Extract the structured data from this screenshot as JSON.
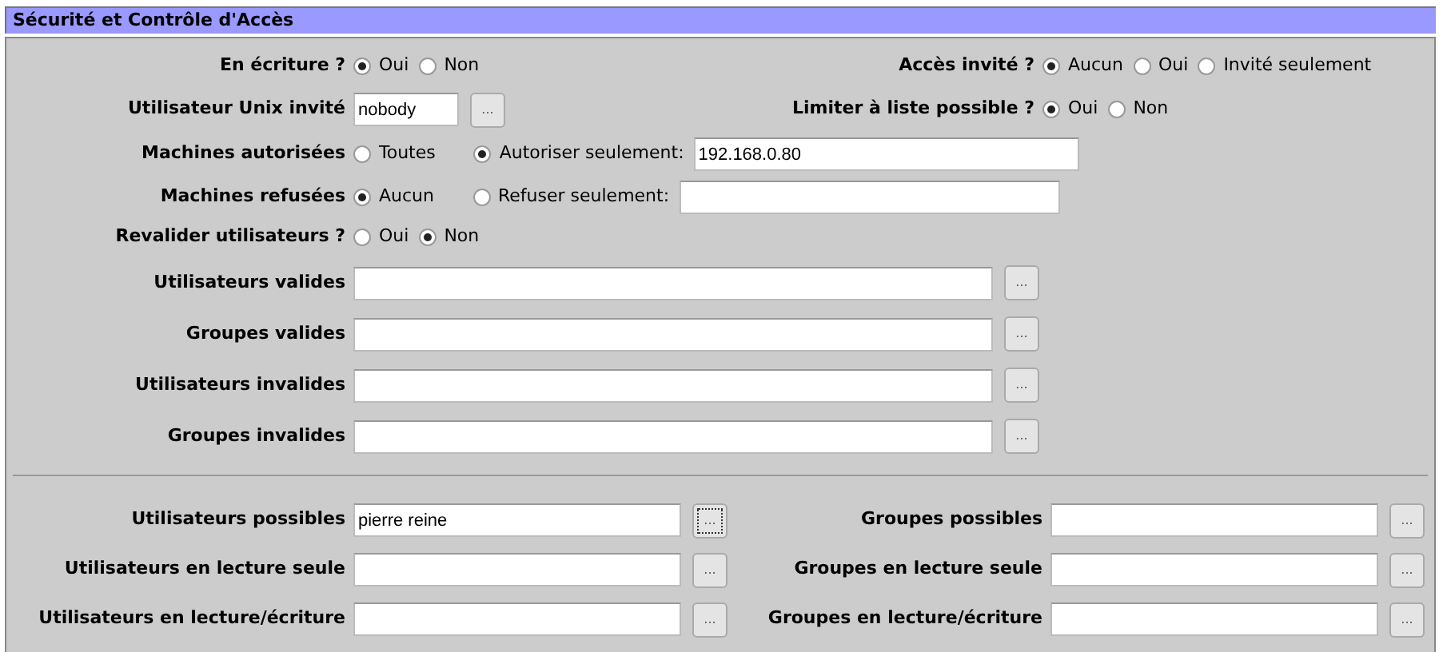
{
  "section": {
    "title": "Sécurité et Contrôle d'Accès"
  },
  "writable": {
    "label": "En écriture ?",
    "options": [
      {
        "label": "Oui",
        "selected": true
      },
      {
        "label": "Non",
        "selected": false
      }
    ]
  },
  "guest_access": {
    "label": "Accès invité ?",
    "options": [
      {
        "label": "Aucun",
        "selected": true
      },
      {
        "label": "Oui",
        "selected": false
      },
      {
        "label": "Invité seulement",
        "selected": false
      }
    ]
  },
  "guest_unix_user": {
    "label": "Utilisateur Unix invité",
    "value": "nobody",
    "button": "..."
  },
  "limit_to_possible": {
    "label": "Limiter à liste possible ?",
    "options": [
      {
        "label": "Oui",
        "selected": true
      },
      {
        "label": "Non",
        "selected": false
      }
    ]
  },
  "allowed_hosts": {
    "label": "Machines autorisées",
    "options": [
      {
        "label": "Toutes",
        "selected": false
      },
      {
        "label": "Autoriser seulement:",
        "selected": true
      }
    ],
    "value": "192.168.0.80"
  },
  "denied_hosts": {
    "label": "Machines refusées",
    "options": [
      {
        "label": "Aucun",
        "selected": true
      },
      {
        "label": "Refuser seulement:",
        "selected": false
      }
    ]
  },
  "revalidate": {
    "label": "Revalider utilisateurs ?",
    "options": [
      {
        "label": "Oui",
        "selected": false
      },
      {
        "label": "Non",
        "selected": true
      }
    ]
  },
  "user_lists": [
    {
      "label": "Utilisateurs valides",
      "button": "..."
    },
    {
      "label": "Groupes valides",
      "button": "..."
    },
    {
      "label": "Utilisateurs invalides",
      "button": "..."
    },
    {
      "label": "Groupes invalides",
      "button": "..."
    }
  ],
  "access_lists": [
    {
      "left": {
        "label": "Utilisateurs possibles",
        "value": "pierre reine",
        "button": "...",
        "focused": true
      },
      "right": {
        "label": "Groupes possibles",
        "button": "...",
        "focused": false
      }
    },
    {
      "left": {
        "label": "Utilisateurs en lecture seule",
        "button": "...",
        "focused": false
      },
      "right": {
        "label": "Groupes en lecture seule",
        "button": "...",
        "focused": false
      }
    },
    {
      "left": {
        "label": "Utilisateurs en lecture/écriture",
        "button": "...",
        "focused": false
      },
      "right": {
        "label": "Groupes en lecture/écriture",
        "button": "...",
        "focused": false
      }
    }
  ]
}
